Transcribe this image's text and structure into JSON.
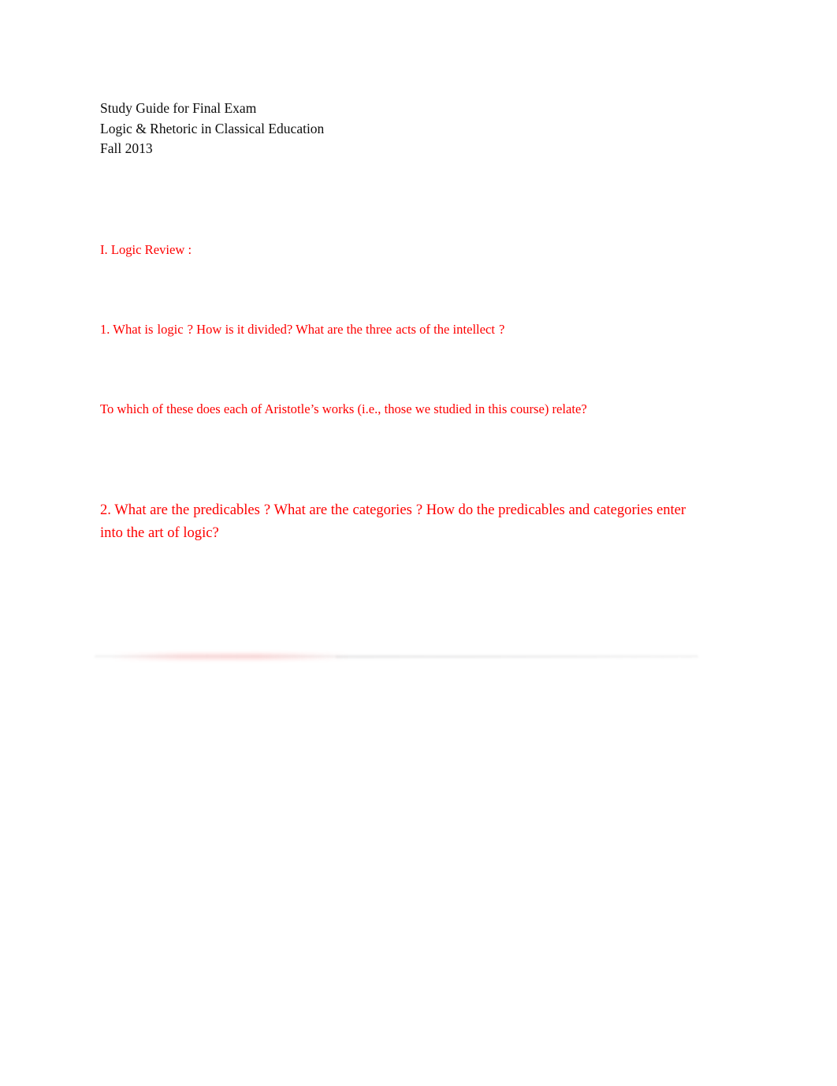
{
  "document": {
    "title": "Study Guide for Final Exam",
    "course": "Logic & Rhetoric in Classical Education",
    "term": "Fall 2013"
  },
  "colors": {
    "body_text": "#0d0d0d",
    "question_text": "#fe0000",
    "page_background": "#ffffff"
  },
  "sections": {
    "logic_review": {
      "heading": "I. Logic Review :",
      "question_1": {
        "number": "1.",
        "part_a_before": "1. What is",
        "term_1": "logic",
        "part_b": "? How is it divided? What are the three",
        "term_2": "acts of the intellect",
        "part_c": "?",
        "line_2": "To which of these does each of Aristotle’s works (i.e., those we studied in this course) relate?"
      },
      "question_2": {
        "number": "2.",
        "part_a_before": "2. What are the",
        "term_1": "predicables",
        "part_b": "? What are the",
        "term_2": "categories",
        "part_c": "? How do the predicables and categories enter into the art of logic?"
      }
    }
  }
}
